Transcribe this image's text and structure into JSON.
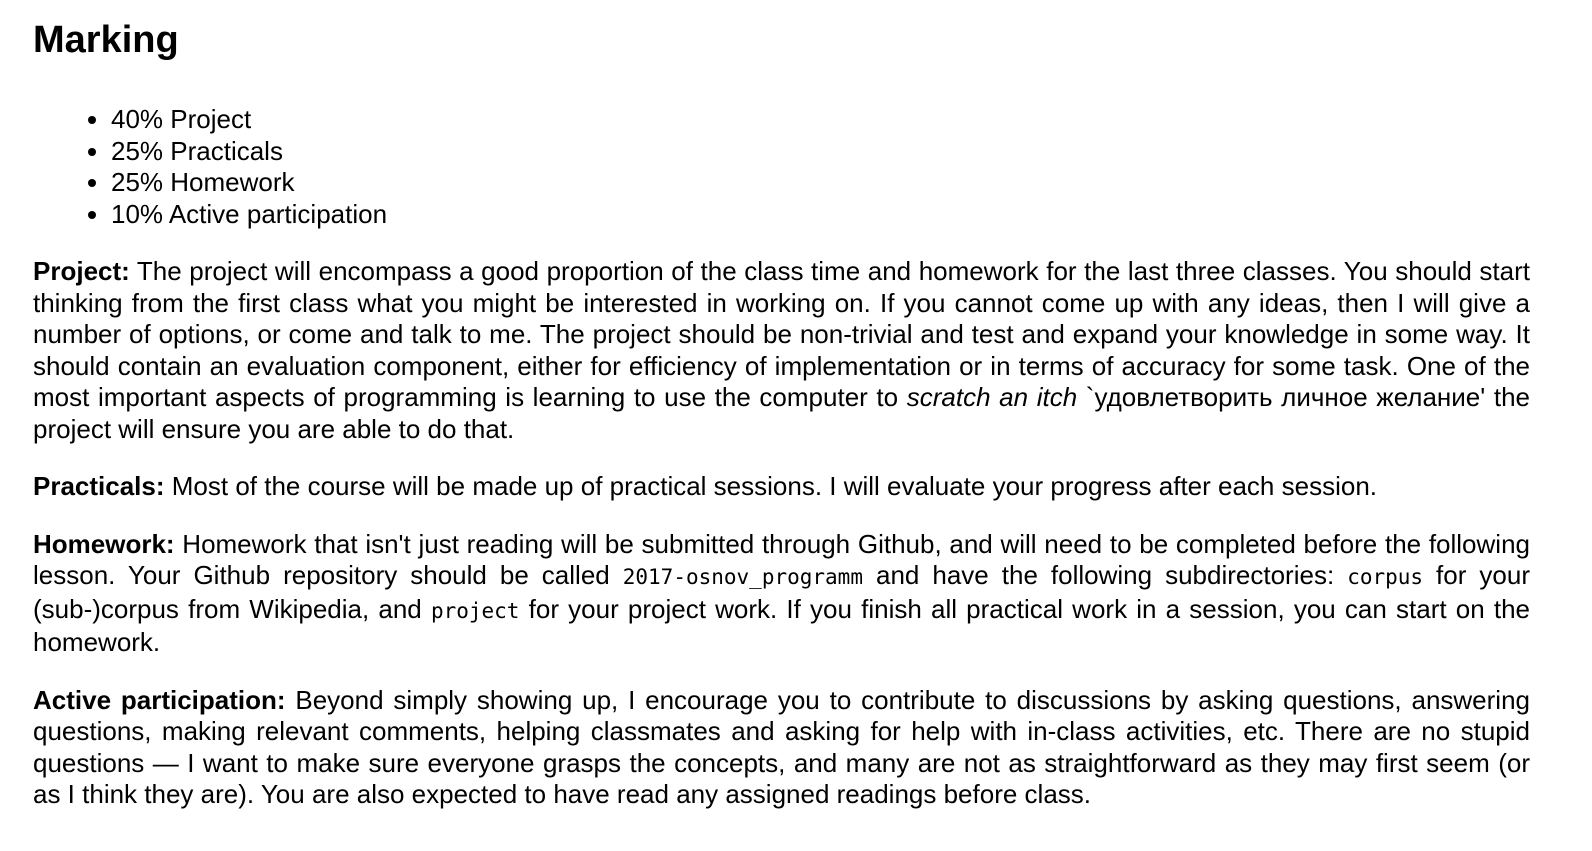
{
  "heading": "Marking",
  "marking_items": [
    "40% Project",
    "25% Practicals",
    "25% Homework",
    "10% Active participation"
  ],
  "project": {
    "label": "Project:",
    "text_1": " The project will encompass a good proportion of the class time and homework for the last three classes. You should start thinking from the first class what you might be interested in working on. If you cannot come up with any ideas, then I will give a number of options, or come and talk to me. The project should be non-trivial and test and expand your knowledge in some way. It should contain an evaluation component, either for efficiency of implementation or in terms of accuracy for some task. One of the most important aspects of programming is learning to use the computer to ",
    "emphasis": "scratch an itch",
    "text_2": " `удовлетворить личное желание' the project will ensure you are able to do that."
  },
  "practicals": {
    "label": "Practicals:",
    "text": " Most of the course will be made up of practical sessions. I will evaluate your progress after each session."
  },
  "homework": {
    "label": "Homework:",
    "text_1": " Homework that isn't just reading will be submitted through Github, and will need to be completed before the following lesson. Your Github repository should be called ",
    "repo_name": "2017-osnov_programm",
    "text_2": " and have the following subdirectories: ",
    "dir_corpus": "corpus",
    "text_3": " for your (sub-)corpus from Wikipedia, and ",
    "dir_project": "project",
    "text_4": " for your project work. If you finish all practical work in a session, you can start on the homework."
  },
  "participation": {
    "label": "Active participation:",
    "text": " Beyond simply showing up, I encourage you to contribute to discussions by asking questions, answering questions, making relevant comments, helping classmates and asking for help with in-class activities, etc. There are no stupid questions — I want to make sure everyone grasps the concepts, and many are not as straightforward as they may first seem (or as I think they are). You are also expected to have read any assigned readings before class."
  }
}
